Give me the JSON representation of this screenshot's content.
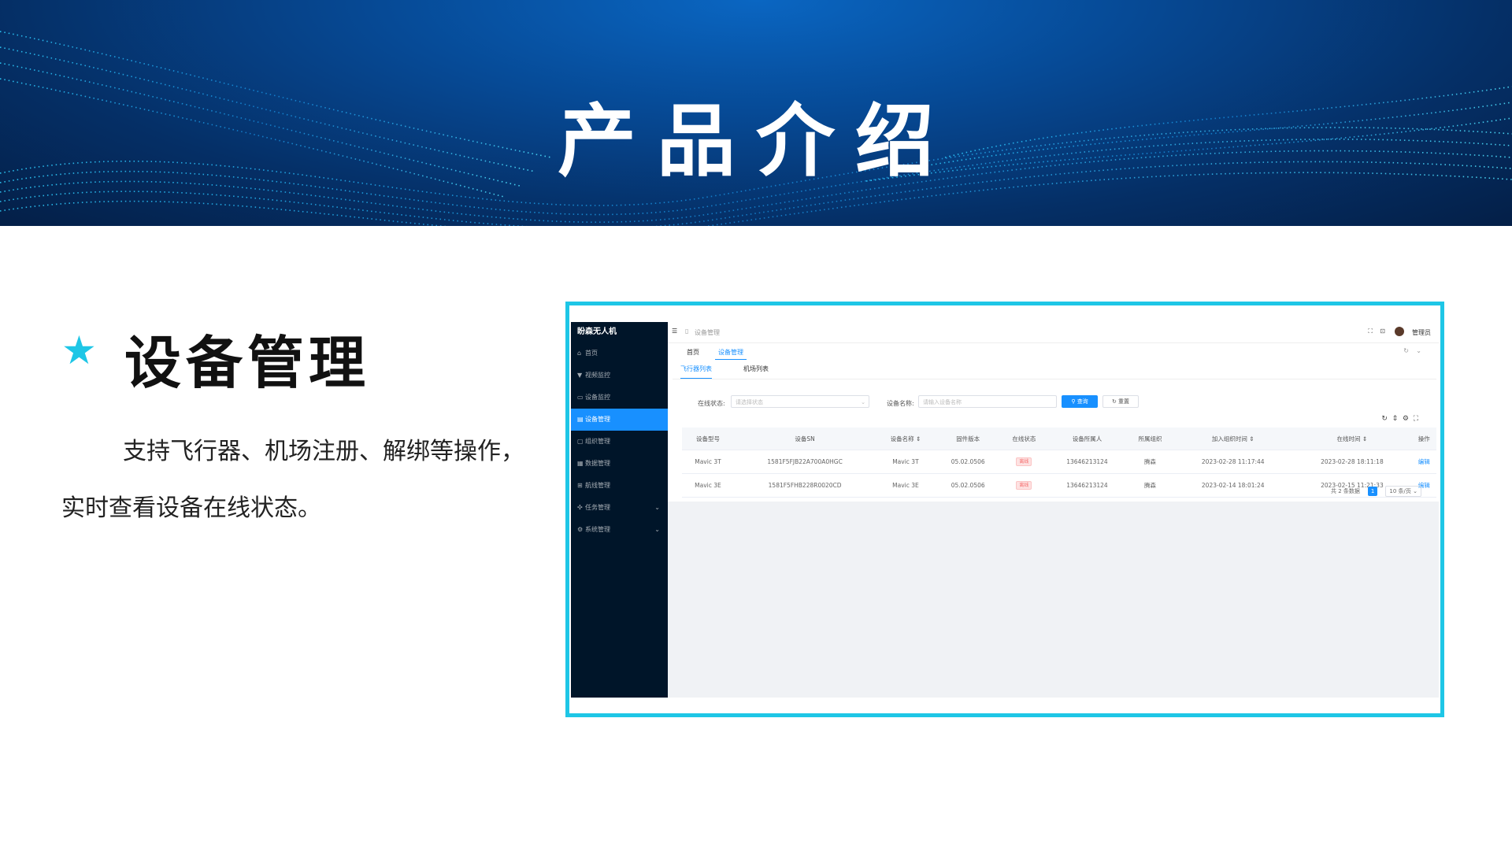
{
  "banner": {
    "title": "产品介绍"
  },
  "section": {
    "title": "设备管理",
    "description": "支持飞行器、机场注册、解绑等操作，实时查看设备在线状态。"
  },
  "colors": {
    "accent": "#1ec6e6",
    "banner": "#064a96",
    "sidebar": "#001529",
    "primary": "#1890ff"
  },
  "app": {
    "brand": "盼森无人机",
    "sidebar": [
      {
        "icon": "home-icon",
        "label": "首页"
      },
      {
        "icon": "filter-icon",
        "label": "视频监控"
      },
      {
        "icon": "monitor-icon",
        "label": "设备监控"
      },
      {
        "icon": "device-icon",
        "label": "设备管理",
        "active": true
      },
      {
        "icon": "screen-icon",
        "label": "组织管理"
      },
      {
        "icon": "data-icon",
        "label": "数据管理"
      },
      {
        "icon": "route-icon",
        "label": "航线管理"
      },
      {
        "icon": "task-icon",
        "label": "任务管理",
        "expandable": true
      },
      {
        "icon": "settings-icon",
        "label": "系统管理",
        "expandable": true
      }
    ],
    "breadcrumb": "设备管理",
    "user": "管理员",
    "tags": [
      "首页",
      "设备管理"
    ],
    "subtabs": [
      "飞行器列表",
      "机场列表"
    ],
    "filters": {
      "status_label": "在线状态:",
      "status_placeholder": "请选择状态",
      "name_label": "设备名称:",
      "name_placeholder": "请输入设备名称",
      "search": "查询",
      "reset": "重置"
    },
    "table": {
      "columns": [
        "设备型号",
        "设备SN",
        "设备名称 ⇕",
        "固件版本",
        "在线状态",
        "设备所属人",
        "所属组织",
        "加入组织时间 ⇕",
        "在线时间 ⇕",
        "操作"
      ],
      "rows": [
        [
          "Mavic 3T",
          "1581F5FJB22A700A0HGC",
          "Mavic 3T",
          "05.02.0506",
          "离线",
          "13646213124",
          "腾森",
          "2023-02-28 11:17:44",
          "2023-02-28 18:11:18",
          "编辑"
        ],
        [
          "Mavic 3E",
          "1581F5FHB228R0020CD",
          "Mavic 3E",
          "05.02.0506",
          "离线",
          "13646213124",
          "腾森",
          "2023-02-14 18:01:24",
          "2023-02-15 11:21:33",
          "编辑"
        ]
      ]
    },
    "pagination": {
      "total": "共 2 条数据",
      "page": "1",
      "size": "10 条/页"
    }
  }
}
